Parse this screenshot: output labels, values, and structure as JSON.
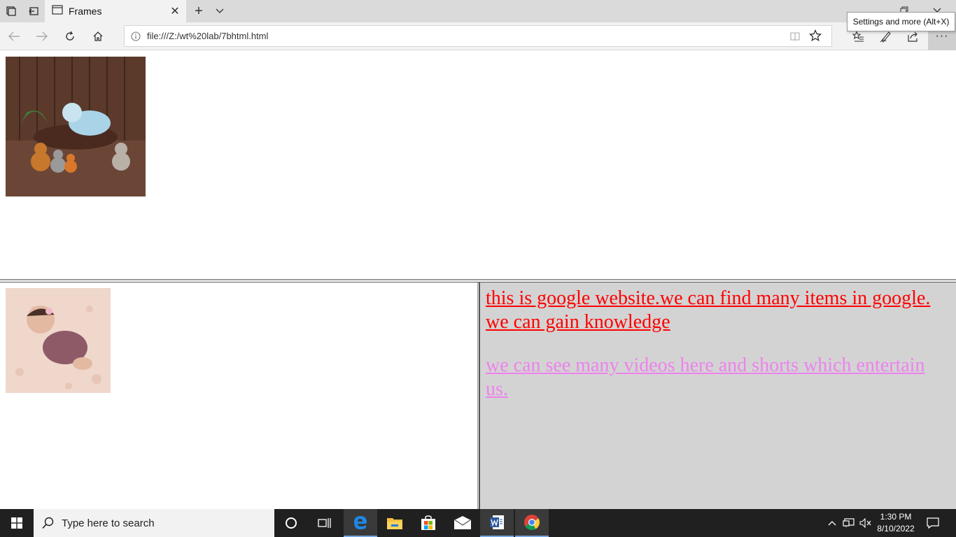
{
  "browser": {
    "tab_title": "Frames",
    "address": "file:///Z:/wt%20lab/7bhtml.html",
    "tooltip": "Settings and more (Alt+X)",
    "more_label": "···"
  },
  "frames": {
    "top": {
      "image_icon": "baby-sleeping-photo-icon"
    },
    "left": {
      "image_icon": "newborn-photo-icon"
    },
    "right": {
      "link1": "this is google website.we can find many items in google. we can gain knowledge",
      "link2": "we can see many videos here and shorts which entertain us.",
      "link1_color": "#ff0000",
      "link2_color": "#ee82ee",
      "background": "#d3d3d3"
    }
  },
  "taskbar": {
    "search_placeholder": "Type here to search",
    "time": "1:30 PM",
    "date": "8/10/2022"
  }
}
